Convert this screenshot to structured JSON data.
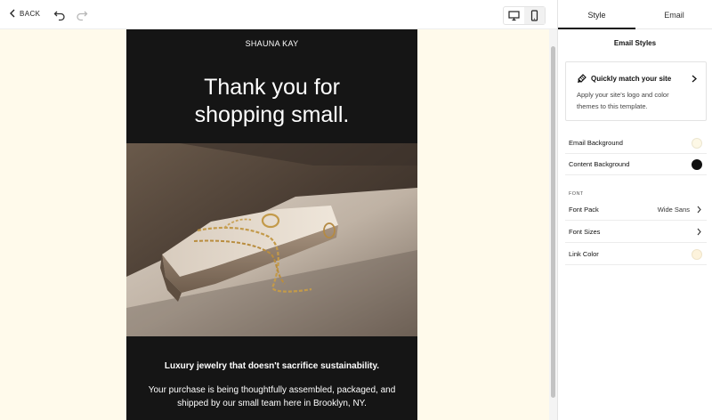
{
  "toolbar": {
    "back_label": "BACK",
    "undo_icon": "undo-icon",
    "redo_icon": "redo-icon",
    "device_modes": [
      "desktop",
      "mobile"
    ],
    "active_device": "mobile"
  },
  "email_preview": {
    "brand_name": "SHAUNA KAY",
    "headline": "Thank you for\nshopping small.",
    "tagline": "Luxury jewelry that doesn't sacrifice sustainability.",
    "body_copy": "Your purchase is being thoughtfully assembled, packaged, and shipped by our small team here in Brooklyn, NY.",
    "page_background_color": "#fffaeb",
    "content_background_color": "#151515"
  },
  "panel": {
    "tabs": [
      {
        "label": "Style",
        "active": true
      },
      {
        "label": "Email",
        "active": false
      }
    ],
    "title": "Email Styles",
    "match_card": {
      "title": "Quickly match your site",
      "description": "Apply your site's logo and color themes to this template."
    },
    "colors": {
      "email_background_label": "Email Background",
      "email_background_color": "#fdf8e6",
      "content_background_label": "Content Background",
      "content_background_color": "#111111"
    },
    "font_section_label": "FONT",
    "font_pack_label": "Font Pack",
    "font_pack_value": "Wide Sans",
    "font_sizes_label": "Font Sizes",
    "link_color_label": "Link Color",
    "link_color": "#fdf3dc"
  }
}
